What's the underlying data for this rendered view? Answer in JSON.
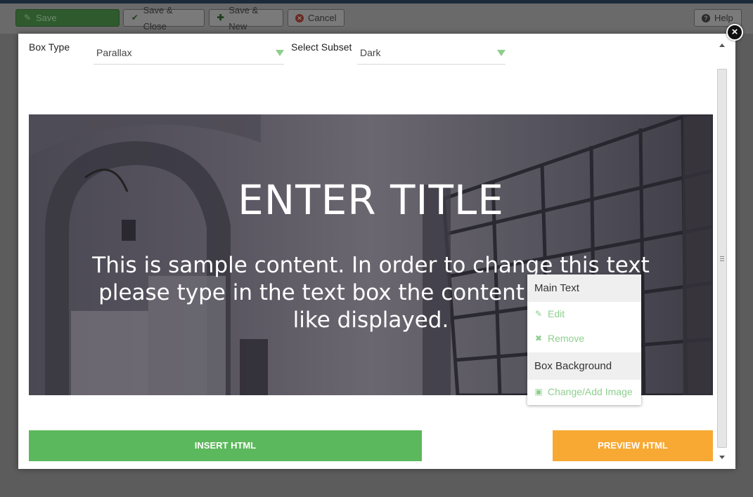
{
  "toolbar": {
    "save_label": "Save",
    "save_close_label": "Save & Close",
    "save_new_label": "Save & New",
    "cancel_label": "Cancel",
    "help_label": "Help"
  },
  "form": {
    "box_type_label": "Box Type",
    "box_type_value": "Parallax",
    "subset_label": "Select Subset",
    "subset_value": "Dark"
  },
  "hero": {
    "title": "ENTER TITLE",
    "text": "This is sample content. In order to change this text please type in the text box the content you would like displayed."
  },
  "context_menu": {
    "main_text_header": "Main Text",
    "edit_label": "Edit",
    "remove_label": "Remove",
    "box_background_header": "Box Background",
    "change_image_label": "Change/Add Image"
  },
  "actions": {
    "insert_label": "INSERT HTML",
    "preview_label": "PREVIEW HTML"
  },
  "colors": {
    "insert_green": "#5cb85c",
    "preview_orange": "#f7a934",
    "menu_accent": "#8fcf8f"
  }
}
